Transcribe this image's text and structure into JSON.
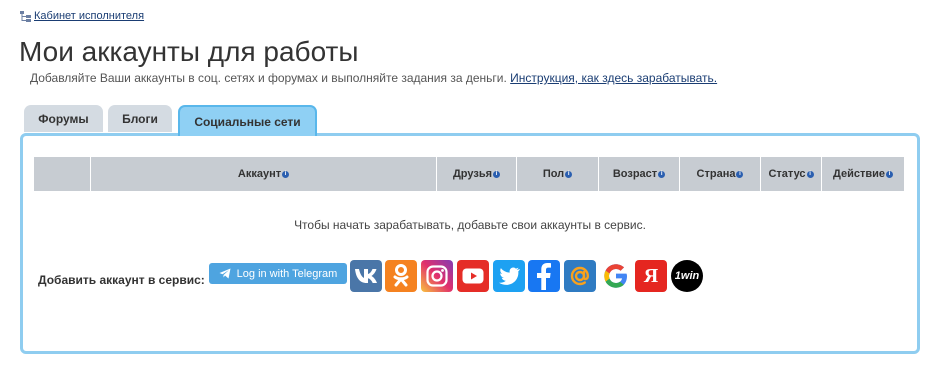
{
  "breadcrumb": {
    "link": "Кабинет исполнителя"
  },
  "page": {
    "title": "Мои аккаунты для работы",
    "subtitle": "Добавляйте Ваши аккаунты в соц. сетях и форумах и выполняйте задания за деньги.",
    "guide_link": "Инструкция, как здесь зарабатывать."
  },
  "tabs": [
    {
      "label": "Форумы"
    },
    {
      "label": "Блоги"
    },
    {
      "label": "Социальные сети",
      "active": true
    }
  ],
  "table": {
    "columns": [
      "",
      "Аккаунт",
      "Друзья",
      "Пол",
      "Возраст",
      "Страна",
      "Статус",
      "Действие"
    ],
    "info_glyph": "i",
    "empty_message": "Чтобы начать зарабатывать, добавьте свои аккаунты в сервис."
  },
  "add": {
    "label": "Добавить аккаунт в сервис:",
    "telegram_button": "Log in with Telegram",
    "services": [
      {
        "icon": "vk-icon",
        "color": "#4a76a8"
      },
      {
        "icon": "odnoklassniki-icon",
        "color": "#f58220"
      },
      {
        "icon": "instagram-icon",
        "color": "#c13584"
      },
      {
        "icon": "youtube-icon",
        "color": "#e52d27"
      },
      {
        "icon": "twitter-icon",
        "color": "#1da1f2"
      },
      {
        "icon": "facebook-icon",
        "color": "#1877f2"
      },
      {
        "icon": "mailru-icon",
        "color": "#2f7bc2"
      },
      {
        "icon": "google-icon",
        "color": "#ffffff"
      },
      {
        "icon": "yandex-icon",
        "color": "#e52620"
      },
      {
        "icon": "1win-icon",
        "color": "#000000"
      }
    ],
    "yandex_letter": "Я",
    "win_label": "1win"
  }
}
